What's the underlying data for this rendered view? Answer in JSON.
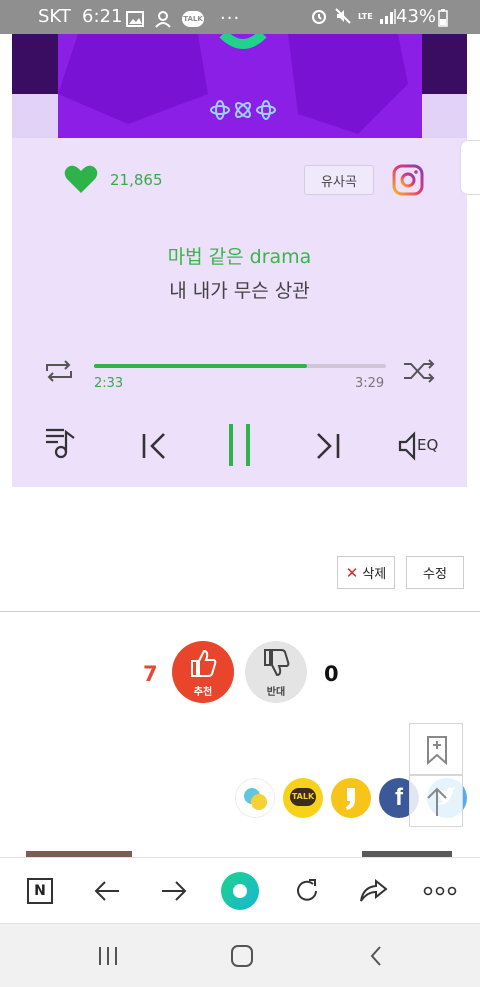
{
  "status_bar": {
    "carrier": "SKT",
    "time": "6:21",
    "network": "LTE",
    "battery": "43%",
    "icons": [
      "image-icon",
      "person-icon",
      "talk-icon",
      "more-dots-icon",
      "alarm-icon",
      "mute-icon",
      "signal-icon",
      "battery-icon"
    ],
    "talk_badge": "TALK"
  },
  "player": {
    "like_count": "21,865",
    "similar_songs_label": "유사곡",
    "lyric_current": "마법 같은 drama",
    "lyric_next": "내 내가 무슨 상관",
    "elapsed_time": "2:33",
    "total_time": "3:29",
    "progress": 0.73,
    "eq_label": "EQ",
    "controls": [
      "repeat-icon",
      "shuffle-icon",
      "playlist-icon",
      "previous-icon",
      "pause-icon",
      "next-icon",
      "eq-icon"
    ],
    "colors": {
      "accent": "#2db34a",
      "background": "#ece0fb",
      "album_purple": "#8b1fe6"
    }
  },
  "post_actions": {
    "delete_label": "삭제",
    "edit_label": "수정"
  },
  "votes": {
    "up_count": "7",
    "up_label": "추천",
    "down_label": "반대",
    "down_count": "0"
  },
  "share": {
    "kakao_talk_label": "TALK",
    "items": [
      "band-icon",
      "kakaotalk-icon",
      "kakaostory-icon",
      "facebook-icon",
      "twitter-icon"
    ]
  },
  "browser_toolbar": {
    "items": [
      "naver-n-icon",
      "back-arrow-icon",
      "forward-arrow-icon",
      "green-home-icon",
      "reload-icon",
      "share-icon",
      "more-icon"
    ],
    "n_label": "N"
  },
  "nav_bar": {
    "items": [
      "recent-apps-icon",
      "home-icon",
      "back-icon"
    ]
  }
}
